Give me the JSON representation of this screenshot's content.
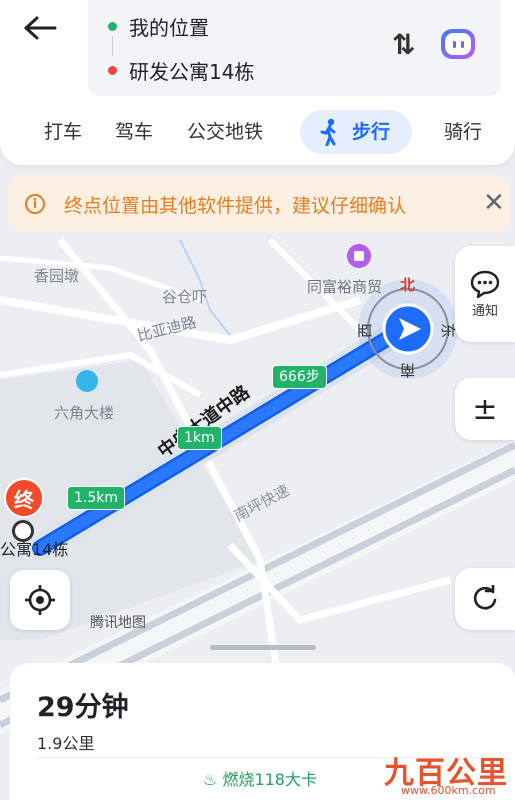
{
  "header": {
    "origin": "我的位置",
    "destination": "研发公寓14栋",
    "swap_icon": "swap-icon",
    "assistant_icon": "assistant-icon"
  },
  "modes": [
    {
      "label": "打车"
    },
    {
      "label": "驾车"
    },
    {
      "label": "公交地铁"
    },
    {
      "label": "步行",
      "active": true
    },
    {
      "label": "骑行"
    }
  ],
  "notice": {
    "text": "终点位置由其他软件提供，建议仔细确认"
  },
  "side_buttons": {
    "notify_label": "通知",
    "zoom_in": "±"
  },
  "map": {
    "labels": {
      "xiangyuandun": "香园墩",
      "gucangka": "谷仓吓",
      "biyadi_road": "比亚迪路",
      "liujiao_building": "六角大楼",
      "tongfuyu": "同富裕商贸",
      "main_road": "中央大道中路",
      "expressway": "南坪快速",
      "destination": "公寓14栋",
      "attribution": "腾讯地图"
    },
    "distance_tags": [
      "666步",
      "1km",
      "1.5km"
    ],
    "end_marker": "终",
    "compass": {
      "north": "北",
      "south": "南",
      "east": "东",
      "west": "西"
    }
  },
  "summary": {
    "eta": "29分钟",
    "distance": "1.9公里",
    "calories": "燃烧118大卡"
  },
  "watermark": {
    "logo": "九百公里",
    "url": "www.600km.com"
  },
  "colors": {
    "route": "#1e6cff",
    "accent": "#1e6cff",
    "warning": "#e67e22",
    "distance_tag": "#22b36b",
    "end_marker": "#f24b2a"
  }
}
